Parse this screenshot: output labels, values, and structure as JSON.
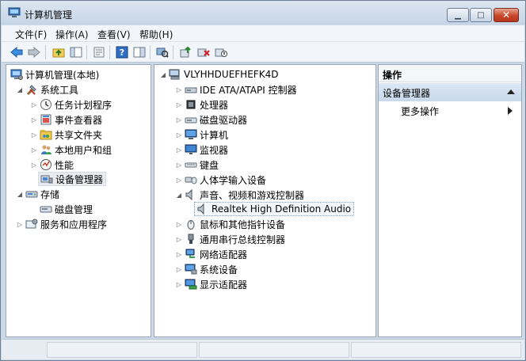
{
  "window": {
    "title": "计算机管理",
    "controls": {
      "minimize": "▁",
      "maximize": "□",
      "close": "✕"
    }
  },
  "menu": [
    {
      "label": "文件(F)"
    },
    {
      "label": "操作(A)"
    },
    {
      "label": "查看(V)"
    },
    {
      "label": "帮助(H)"
    }
  ],
  "toolbar": {
    "buttons": [
      "back-icon",
      "forward-icon",
      "up-folder-icon",
      "show-hide-tree-icon",
      "properties-icon",
      "help-icon",
      "show-action-pane-icon",
      "scan-hardware-icon",
      "update-driver-icon",
      "uninstall-icon",
      "disable-device-icon"
    ]
  },
  "left_tree": {
    "root": "计算机管理(本地)",
    "system_tools": "系统工具",
    "system_tools_items": [
      "任务计划程序",
      "事件查看器",
      "共享文件夹",
      "本地用户和组",
      "性能",
      "设备管理器"
    ],
    "storage": "存储",
    "storage_items": [
      "磁盘管理"
    ],
    "services": "服务和应用程序"
  },
  "device_tree": {
    "computer": "VLYHHDUEFHEFK4D",
    "categories_a": [
      "IDE ATA/ATAPI 控制器",
      "处理器",
      "磁盘驱动器",
      "计算机",
      "监视器",
      "键盘",
      "人体学输入设备"
    ],
    "sound_category": "声音、视频和游戏控制器",
    "sound_device": "Realtek High Definition Audio",
    "categories_b": [
      "鼠标和其他指针设备",
      "通用串行总线控制器",
      "网络适配器",
      "系统设备",
      "显示适配器"
    ]
  },
  "actions": {
    "header": "操作",
    "section": "设备管理器",
    "more": "更多操作"
  }
}
